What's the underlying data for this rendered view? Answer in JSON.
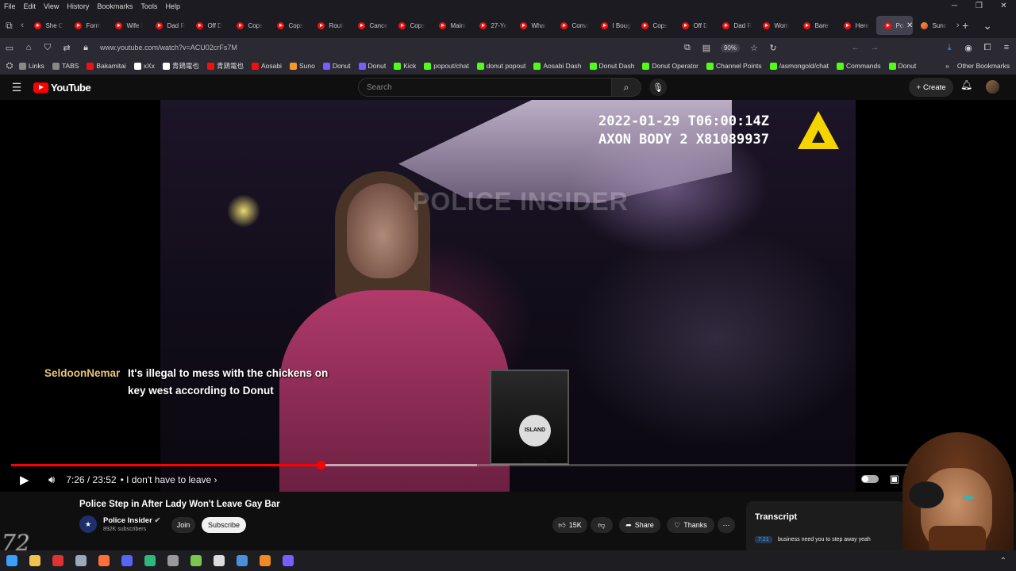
{
  "menubar": {
    "items": [
      "File",
      "Edit",
      "View",
      "History",
      "Bookmarks",
      "Tools",
      "Help"
    ],
    "minimize": "─",
    "restore": "❐",
    "close": "✕"
  },
  "tabs": [
    {
      "label": "She C"
    },
    {
      "label": "Form"
    },
    {
      "label": "Wife I"
    },
    {
      "label": "Dad R"
    },
    {
      "label": "Off D"
    },
    {
      "label": "Cops"
    },
    {
      "label": "Cops"
    },
    {
      "label": "Routi"
    },
    {
      "label": "Cance"
    },
    {
      "label": "Cops"
    },
    {
      "label": "Maint"
    },
    {
      "label": "27-Ye"
    },
    {
      "label": "What"
    },
    {
      "label": "Convi"
    },
    {
      "label": "I Boug"
    },
    {
      "label": "Cops"
    },
    {
      "label": "Off D"
    },
    {
      "label": "Dad R"
    },
    {
      "label": "Wom"
    },
    {
      "label": "Bare-"
    },
    {
      "label": "Here"
    },
    {
      "label": "Pol",
      "active": true
    },
    {
      "label": "Suno",
      "suno": true
    }
  ],
  "tab_close": "✕",
  "tabbar": {
    "new_tab": "+",
    "list_tabs": "⌄"
  },
  "navbar": {
    "url": "www.youtube.com/watch?v=ACU02crFs7M",
    "zoom": "90%"
  },
  "bookmarks": [
    {
      "label": "Links",
      "color": "#888"
    },
    {
      "label": "TABS",
      "color": "#888"
    },
    {
      "label": "Bakamitai",
      "color": "#e11"
    },
    {
      "label": "xXx",
      "color": "#fff"
    },
    {
      "label": "青鶏電也",
      "color": "#fff"
    },
    {
      "label": "青鶏電也",
      "color": "#e11"
    },
    {
      "label": "Aosabi",
      "color": "#e11"
    },
    {
      "label": "Suno",
      "color": "#f39a2a"
    },
    {
      "label": "Donut",
      "color": "#7b5cff"
    },
    {
      "label": "Donut",
      "color": "#7b5cff"
    },
    {
      "label": "Kick",
      "color": "#53fc18"
    },
    {
      "label": "popout/chat",
      "color": "#53fc18"
    },
    {
      "label": "donut popout",
      "color": "#53fc18"
    },
    {
      "label": "Aosabi Dash",
      "color": "#53fc18"
    },
    {
      "label": "Donut Dash",
      "color": "#53fc18"
    },
    {
      "label": "Donut Operator",
      "color": "#53fc18"
    },
    {
      "label": "Channel Points",
      "color": "#53fc18"
    },
    {
      "label": "/asmongold/chat",
      "color": "#53fc18"
    },
    {
      "label": "Commands",
      "color": "#53fc18"
    },
    {
      "label": "Donut",
      "color": "#53fc18"
    }
  ],
  "bookmarks_more": "»",
  "other_bookmarks": "Other Bookmarks",
  "youtube": {
    "brand": "YouTube",
    "search_placeholder": "Search",
    "create": "Create"
  },
  "video": {
    "timestamp_line": "2022-01-29 T06:00:14Z",
    "device_line": "AXON BODY 2 X81089937",
    "watermark": "POLICE INSIDER",
    "sign_text": "ISLAND SALOON",
    "chat_user": "SeldoonNemar",
    "chat_message": "It's illegal to mess with the chickens on key west according to Donut",
    "current_time": "7:26",
    "duration": "23:52",
    "time_display": "7:26 / 23:52",
    "chapter": "• I don't have to leave ›",
    "progress_fraction": 0.3115,
    "buffered_fraction": 0.4686
  },
  "info": {
    "title": "Police Step in After Lady Won't Leave Gay Bar",
    "channel": "Police Insider",
    "subscribers": "892K subscribers",
    "join": "Join",
    "subscribe": "Subscribe",
    "likes": "15K",
    "share": "Share",
    "thanks": "Thanks",
    "more": "⋯"
  },
  "transcript": {
    "title": "Transcript",
    "timestamp": "7:21",
    "text": "business need you to step away yeah"
  },
  "overlay_logo": "72",
  "taskbar": {
    "icons": [
      {
        "name": "windows",
        "color": "#3aa0ff"
      },
      {
        "name": "file-explorer",
        "color": "#f2c14e"
      },
      {
        "name": "app-red",
        "color": "#d33"
      },
      {
        "name": "steam",
        "color": "#9ab"
      },
      {
        "name": "firefox",
        "color": "#ff7139"
      },
      {
        "name": "discord",
        "color": "#5865f2"
      },
      {
        "name": "chat",
        "color": "#2db87c"
      },
      {
        "name": "game",
        "color": "#999"
      },
      {
        "name": "notes",
        "color": "#7ac74f"
      },
      {
        "name": "git",
        "color": "#ddd"
      },
      {
        "name": "steam-2",
        "color": "#4a90d9"
      },
      {
        "name": "vlc",
        "color": "#f08a24"
      },
      {
        "name": "obs",
        "color": "#7b5cff"
      }
    ]
  }
}
